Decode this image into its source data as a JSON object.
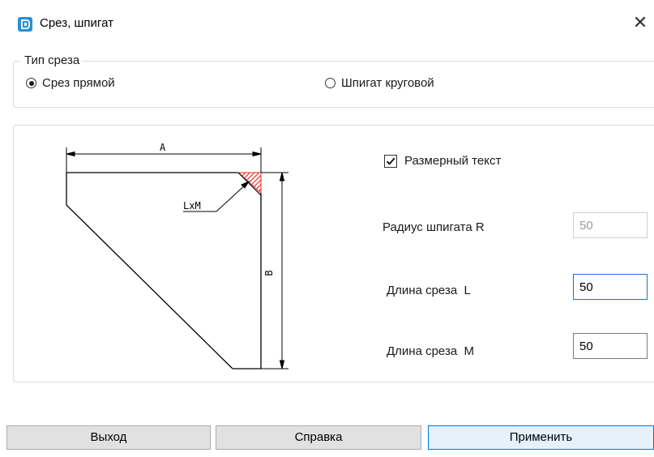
{
  "window": {
    "title": "Срез, шпигат",
    "close_glyph": "✕",
    "app_icon": "app-logo-icon"
  },
  "cut_type_group": {
    "legend": "Тип среза",
    "options": [
      {
        "label": "Срез прямой",
        "selected": true
      },
      {
        "label": "Шпигат круговой",
        "selected": false
      }
    ]
  },
  "diagram": {
    "dim_a": "A",
    "dim_b": "B",
    "dim_lxm": "LxM",
    "hatch_color": "#e8302a"
  },
  "params": {
    "dimension_text": {
      "label": "Размерный текст",
      "checked": true
    },
    "radius": {
      "label": "Радиус шпигата R",
      "value": "50",
      "disabled": true
    },
    "length_l": {
      "label": "Длина среза  L",
      "value": "50"
    },
    "length_m": {
      "label": "Длина среза  M",
      "value": "50"
    }
  },
  "buttons": {
    "exit": "Выход",
    "help": "Справка",
    "apply": "Применить"
  },
  "colors": {
    "accent": "#0078d7",
    "button_bg": "#e1e1e1"
  }
}
